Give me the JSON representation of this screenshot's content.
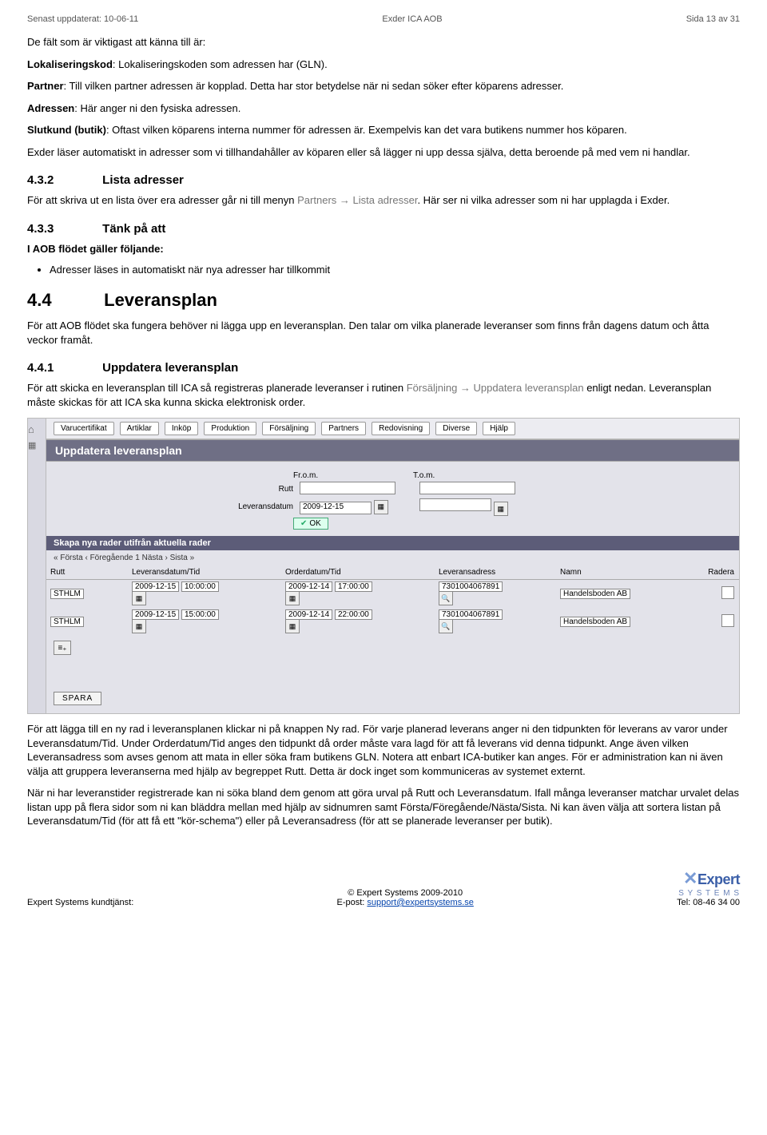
{
  "header": {
    "left": "Senast uppdaterat: 10-06-11",
    "center": "Exder ICA AOB",
    "right": "Sida 13 av 31"
  },
  "intro": {
    "lead": "De fält som är viktigast att känna till är:",
    "items": [
      {
        "term": "Lokaliseringskod",
        "desc": ": Lokaliseringskoden som adressen har (GLN)."
      },
      {
        "term": "Partner",
        "desc": ": Till vilken partner adressen är kopplad. Detta har stor betydelse när ni sedan söker efter köparens adresser."
      },
      {
        "term": "Adressen",
        "desc": ": Här anger ni den fysiska adressen."
      },
      {
        "term": "Slutkund (butik)",
        "desc": ": Oftast vilken köparens interna nummer för adressen är. Exempelvis kan det vara butikens nummer hos köparen."
      }
    ],
    "after": "Exder läser automatiskt in adresser som vi tillhandahåller av köparen eller så lägger ni upp dessa själva, detta beroende på med vem ni handlar."
  },
  "s432": {
    "heading_num": "4.3.2",
    "heading_txt": "Lista adresser",
    "p": {
      "pre": "För att skriva ut en lista över era adresser går ni till menyn ",
      "grey": "Partners → Lista adresser",
      "post": ". Här ser ni vilka adresser som ni har upplagda i Exder."
    }
  },
  "s433": {
    "heading_num": "4.3.3",
    "heading_txt": "Tänk på att",
    "lead": "I AOB flödet gäller följande:",
    "bullet": "Adresser läses in automatiskt när nya adresser har tillkommit"
  },
  "s44": {
    "heading_num": "4.4",
    "heading_txt": "Leveransplan",
    "p": "För att AOB flödet ska fungera behöver ni lägga upp en leveransplan. Den talar om vilka planerade leveranser som finns från dagens datum och åtta veckor framåt."
  },
  "s441": {
    "heading_num": "4.4.1",
    "heading_txt": "Uppdatera leveransplan",
    "p": {
      "pre": "För att skicka en leveransplan till ICA så registreras planerade leveranser i rutinen ",
      "grey": "Försäljning → Uppdatera leveransplan",
      "post": " enligt nedan. Leveransplan måste skickas för att ICA ska kunna skicka elektronisk order."
    }
  },
  "app": {
    "menu": [
      "Varucertifikat",
      "Artiklar",
      "Inköp",
      "Produktion",
      "Försäljning",
      "Partners",
      "Redovisning",
      "Diverse",
      "Hjälp"
    ],
    "title": "Uppdatera leveransplan",
    "filter": {
      "from_lbl": "Fr.o.m.",
      "to_lbl": "T.o.m.",
      "rutt_lbl": "Rutt",
      "levdat_lbl": "Leveransdatum",
      "levdat_val": "2009-12-15",
      "ok": "OK"
    },
    "subbar": "Skapa nya rader utifrån aktuella rader",
    "pager": "« Första ‹ Föregående 1 Nästa › Sista »",
    "cols": [
      "Rutt",
      "Leveransdatum/Tid",
      "Orderdatum/Tid",
      "Leveransadress",
      "Namn",
      "Radera"
    ],
    "rows": [
      {
        "rutt": "STHLM",
        "ld": "2009-12-15",
        "lt": "10:00:00",
        "od": "2009-12-14",
        "ot": "17:00:00",
        "adr": "7301004067891",
        "namn": "Handelsboden AB"
      },
      {
        "rutt": "STHLM",
        "ld": "2009-12-15",
        "lt": "15:00:00",
        "od": "2009-12-14",
        "ot": "22:00:00",
        "adr": "7301004067891",
        "namn": "Handelsboden AB"
      }
    ],
    "spara": "SPARA"
  },
  "after_img": {
    "p1": "För att lägga till en ny rad i leveransplanen klickar ni på knappen Ny rad. För varje planerad leverans anger ni den tidpunkten för leverans av varor under Leveransdatum/Tid. Under Orderdatum/Tid anges den tidpunkt då order måste vara lagd för att få leverans vid denna tidpunkt. Ange även vilken Leveransadress som avses genom att mata in eller söka fram butikens GLN. Notera att enbart ICA-butiker kan anges. För er administration kan ni även välja att gruppera leveranserna med hjälp av begreppet Rutt. Detta är dock inget som kommuniceras av systemet externt.",
    "p2": "När ni har leveranstider registrerade kan ni söka bland dem genom att göra urval på Rutt och Leveransdatum. Ifall många leveranser matchar urvalet delas listan upp på flera sidor som ni kan bläddra mellan med hjälp av sidnumren samt Första/Föregående/Nästa/Sista. Ni kan även välja att sortera listan på Leveransdatum/Tid (för att få ett \"kör-schema\") eller på Leveransadress (för att se planerade leveranser per butik)."
  },
  "footer": {
    "copyright": "© Expert Systems 2009-2010",
    "left": "Expert Systems kundtjänst:",
    "mid_pre": "E-post: ",
    "mid_link": "support@expertsystems.se",
    "right": "Tel: 08-46 34 00",
    "logo_brand": "Expert",
    "logo_sub": "S Y S T E M S"
  }
}
